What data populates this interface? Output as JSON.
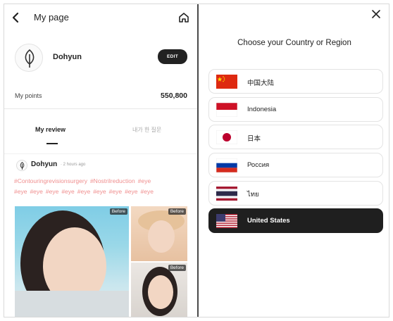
{
  "left_panel": {
    "header": {
      "back_icon": "chevron-left-icon",
      "title": "My page",
      "home_icon": "home-icon"
    },
    "profile": {
      "avatar_icon": "leaf-icon",
      "name": "Dohyun",
      "edit_label": "EDIT"
    },
    "points": {
      "label": "My points",
      "value": "550,800"
    },
    "tabs": [
      {
        "label": "My review",
        "active": true
      },
      {
        "label": "내가 한 질문",
        "active": false
      }
    ],
    "review": {
      "author": "Dohyun",
      "time": "· 2 hours ago",
      "tags": [
        "#Contouringrevisionsurgery",
        "#Nostrilreduction",
        "#eye",
        "#eye",
        "#eye",
        "#eye",
        "#eye",
        "#eye",
        "#eye",
        "#eye",
        "#eye",
        "#eye"
      ],
      "badge_label": "Before"
    }
  },
  "right_panel": {
    "close_icon": "close-icon",
    "title": "Choose your Country or Region",
    "countries": [
      {
        "label": "中国大陆",
        "flag": "china-flag-icon",
        "selected": false
      },
      {
        "label": "Indonesia",
        "flag": "indonesia-flag-icon",
        "selected": false
      },
      {
        "label": "日本",
        "flag": "japan-flag-icon",
        "selected": false
      },
      {
        "label": "Россия",
        "flag": "russia-flag-icon",
        "selected": false
      },
      {
        "label": "ไทย",
        "flag": "thailand-flag-icon",
        "selected": false
      },
      {
        "label": "United States",
        "flag": "usa-flag-icon",
        "selected": true
      }
    ]
  },
  "colors": {
    "accent": "#1f1f1f",
    "tag": "#f08f8f",
    "divider": "#4a4a4a"
  }
}
